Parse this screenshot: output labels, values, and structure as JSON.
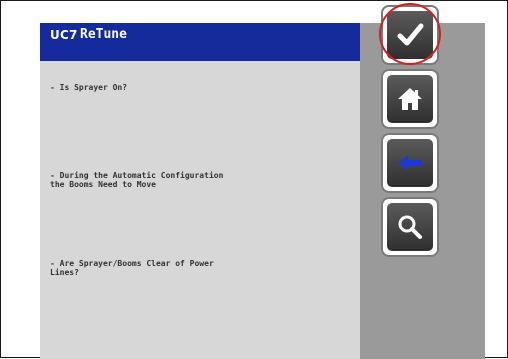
{
  "header": {
    "logo": "UC7",
    "title": "ReTune"
  },
  "messages": [
    "- Is Sprayer On?",
    "- During the Automatic Configuration\nthe Booms Need to Move",
    "- Are Sprayer/Booms Clear of Power\nLines?"
  ],
  "buttons": [
    {
      "icon": "check-icon",
      "highlighted": true
    },
    {
      "icon": "home-icon"
    },
    {
      "icon": "back-arrow-icon",
      "color": "#1a3ad6"
    },
    {
      "icon": "search-icon"
    }
  ],
  "colors": {
    "title_bar": "#152a9b",
    "panel": "#d7d7d7",
    "side_area": "#9a9a9a",
    "highlight": "#d42020"
  }
}
